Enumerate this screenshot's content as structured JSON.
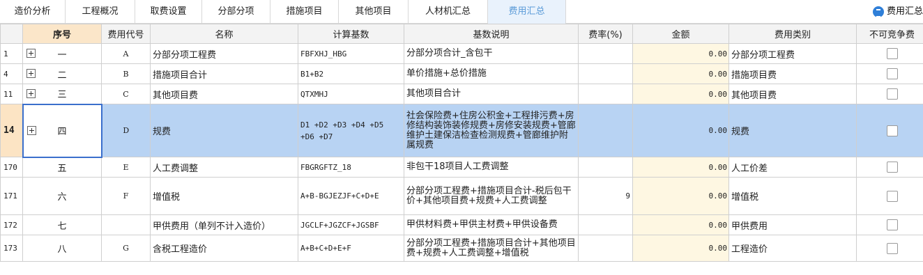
{
  "tabs": [
    "造价分析",
    "工程概况",
    "取费设置",
    "分部分项",
    "措施项目",
    "其他项目",
    "人材机汇总",
    "费用汇总"
  ],
  "active_tab": 7,
  "right_label": "费用汇总",
  "columns": [
    "",
    "序号",
    "费用代号",
    "名称",
    "计算基数",
    "基数说明",
    "费率(%)",
    "金额",
    "费用类别",
    "不可竞争费"
  ],
  "rows": [
    {
      "num": "1",
      "expand": true,
      "seq": "一",
      "code": "A",
      "name": "分部分项工程费",
      "base": "FBFXHJ_HBG",
      "desc": "分部分项合计_含包干",
      "rate": "",
      "amount": "0.00",
      "category": "分部分项工程费"
    },
    {
      "num": "4",
      "expand": true,
      "seq": "二",
      "code": "B",
      "name": "措施项目合计",
      "base": "B1+B2",
      "desc": "单价措施+总价措施",
      "rate": "",
      "amount": "0.00",
      "category": "措施项目费"
    },
    {
      "num": "11",
      "expand": true,
      "seq": "三",
      "code": "C",
      "name": "其他项目费",
      "base": "QTXMHJ",
      "desc": "其他项目合计",
      "rate": "",
      "amount": "0.00",
      "category": "其他项目费"
    },
    {
      "num": "14",
      "expand": true,
      "seq": "四",
      "code": "D",
      "name": "规费",
      "base": "D1 +D2 +D3 +D4 +D5 +D6 +D7",
      "desc": "社会保险费+住房公积金+工程排污费+房修结构装饰装修规费+房修安装规费+管廊维护土建保洁检查检测规费+管廊维护附属规费",
      "rate": "",
      "amount": "0.00",
      "category": "规费",
      "selected": true
    },
    {
      "num": "170",
      "expand": false,
      "seq": "五",
      "code": "E",
      "name": "人工费调整",
      "base": "FBGRGFTZ_18",
      "desc": "非包干18项目人工费调整",
      "rate": "",
      "amount": "0.00",
      "category": "人工价差"
    },
    {
      "num": "171",
      "expand": false,
      "seq": "六",
      "code": "F",
      "name": "增值税",
      "base": "A+B-BGJEZJF+C+D+E",
      "desc": "分部分项工程费+措施项目合计-税后包干价+其他项目费+规费+人工费调整",
      "rate": "9",
      "amount": "0.00",
      "category": "增值税"
    },
    {
      "num": "172",
      "expand": false,
      "seq": "七",
      "code": "",
      "name": "甲供费用（单列不计入造价）",
      "base": "JGCLF+JGZCF+JGSBF",
      "desc": "甲供材料费+甲供主材费+甲供设备费",
      "rate": "",
      "amount": "0.00",
      "category": "甲供费用"
    },
    {
      "num": "173",
      "expand": false,
      "seq": "八",
      "code": "G",
      "name": "含税工程造价",
      "base": "A+B+C+D+E+F",
      "desc": "分部分项工程费+措施项目合计+其他项目费+规费+人工费调整+增值税",
      "rate": "",
      "amount": "0.00",
      "category": "工程造价"
    }
  ]
}
